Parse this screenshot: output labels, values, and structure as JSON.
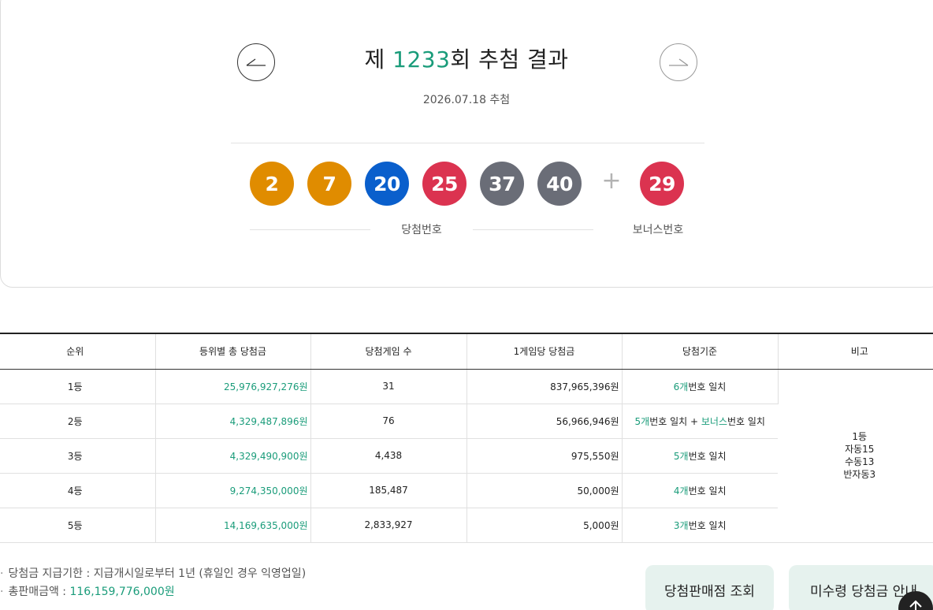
{
  "draw": {
    "title_prefix": "제 ",
    "round": "1233",
    "title_suffix": "회 추첨 결과",
    "date": "2026.07.18 추첨"
  },
  "numbers": {
    "balls": [
      {
        "value": "2",
        "color": "#e08c00"
      },
      {
        "value": "7",
        "color": "#e08c00"
      },
      {
        "value": "20",
        "color": "#0a5fcc"
      },
      {
        "value": "25",
        "color": "#db3350"
      },
      {
        "value": "37",
        "color": "#6a6d77"
      },
      {
        "value": "40",
        "color": "#6a6d77"
      }
    ],
    "plus": "+",
    "bonus": {
      "value": "29",
      "color": "#db3350"
    },
    "winning_label": "당첨번호",
    "bonus_label": "보너스번호"
  },
  "icons": {
    "prev": "arrow-left-icon",
    "next": "arrow-right-icon",
    "top": "arrow-up-icon"
  },
  "table": {
    "headers": [
      "순위",
      "등위별 총 당첨금",
      "당첨게임 수",
      "1게임당 당첨금",
      "당첨기준",
      "비고"
    ],
    "rows": [
      {
        "rank": "1등",
        "total": "25,976,927,276원",
        "games": "31",
        "per_game": "837,965,396원",
        "criteria_a": "6개",
        "criteria_b": "번호 일치"
      },
      {
        "rank": "2등",
        "total": "4,329,487,896원",
        "games": "76",
        "per_game": "56,966,946원",
        "criteria_a": "5개",
        "criteria_b": "번호 일치 + ",
        "criteria_c": "보너스",
        "criteria_d": "번호 일치"
      },
      {
        "rank": "3등",
        "total": "4,329,490,900원",
        "games": "4,438",
        "per_game": "975,550원",
        "criteria_a": "5개",
        "criteria_b": "번호 일치"
      },
      {
        "rank": "4등",
        "total": "9,274,350,000원",
        "games": "185,487",
        "per_game": "50,000원",
        "criteria_a": "4개",
        "criteria_b": "번호 일치"
      },
      {
        "rank": "5등",
        "total": "14,169,635,000원",
        "games": "2,833,927",
        "per_game": "5,000원",
        "criteria_a": "3개",
        "criteria_b": "번호 일치"
      }
    ],
    "note_lines": [
      "1등",
      "자동15",
      "수동13",
      "반자동3"
    ]
  },
  "footer": {
    "bullet": "·",
    "deadline": "당첨금 지급기한 : 지급개시일로부터 1년 (휴일인 경우 익영업일)",
    "total_sales_label": "총판매금액 : ",
    "total_sales_value": "116,159,776,000원",
    "store_button": "당첨판매점 조회",
    "unclaimed_button": "미수령 당첨금 안내"
  },
  "colors": {
    "accent": "#1a9c7a",
    "button_bg": "#e6f2ee"
  }
}
